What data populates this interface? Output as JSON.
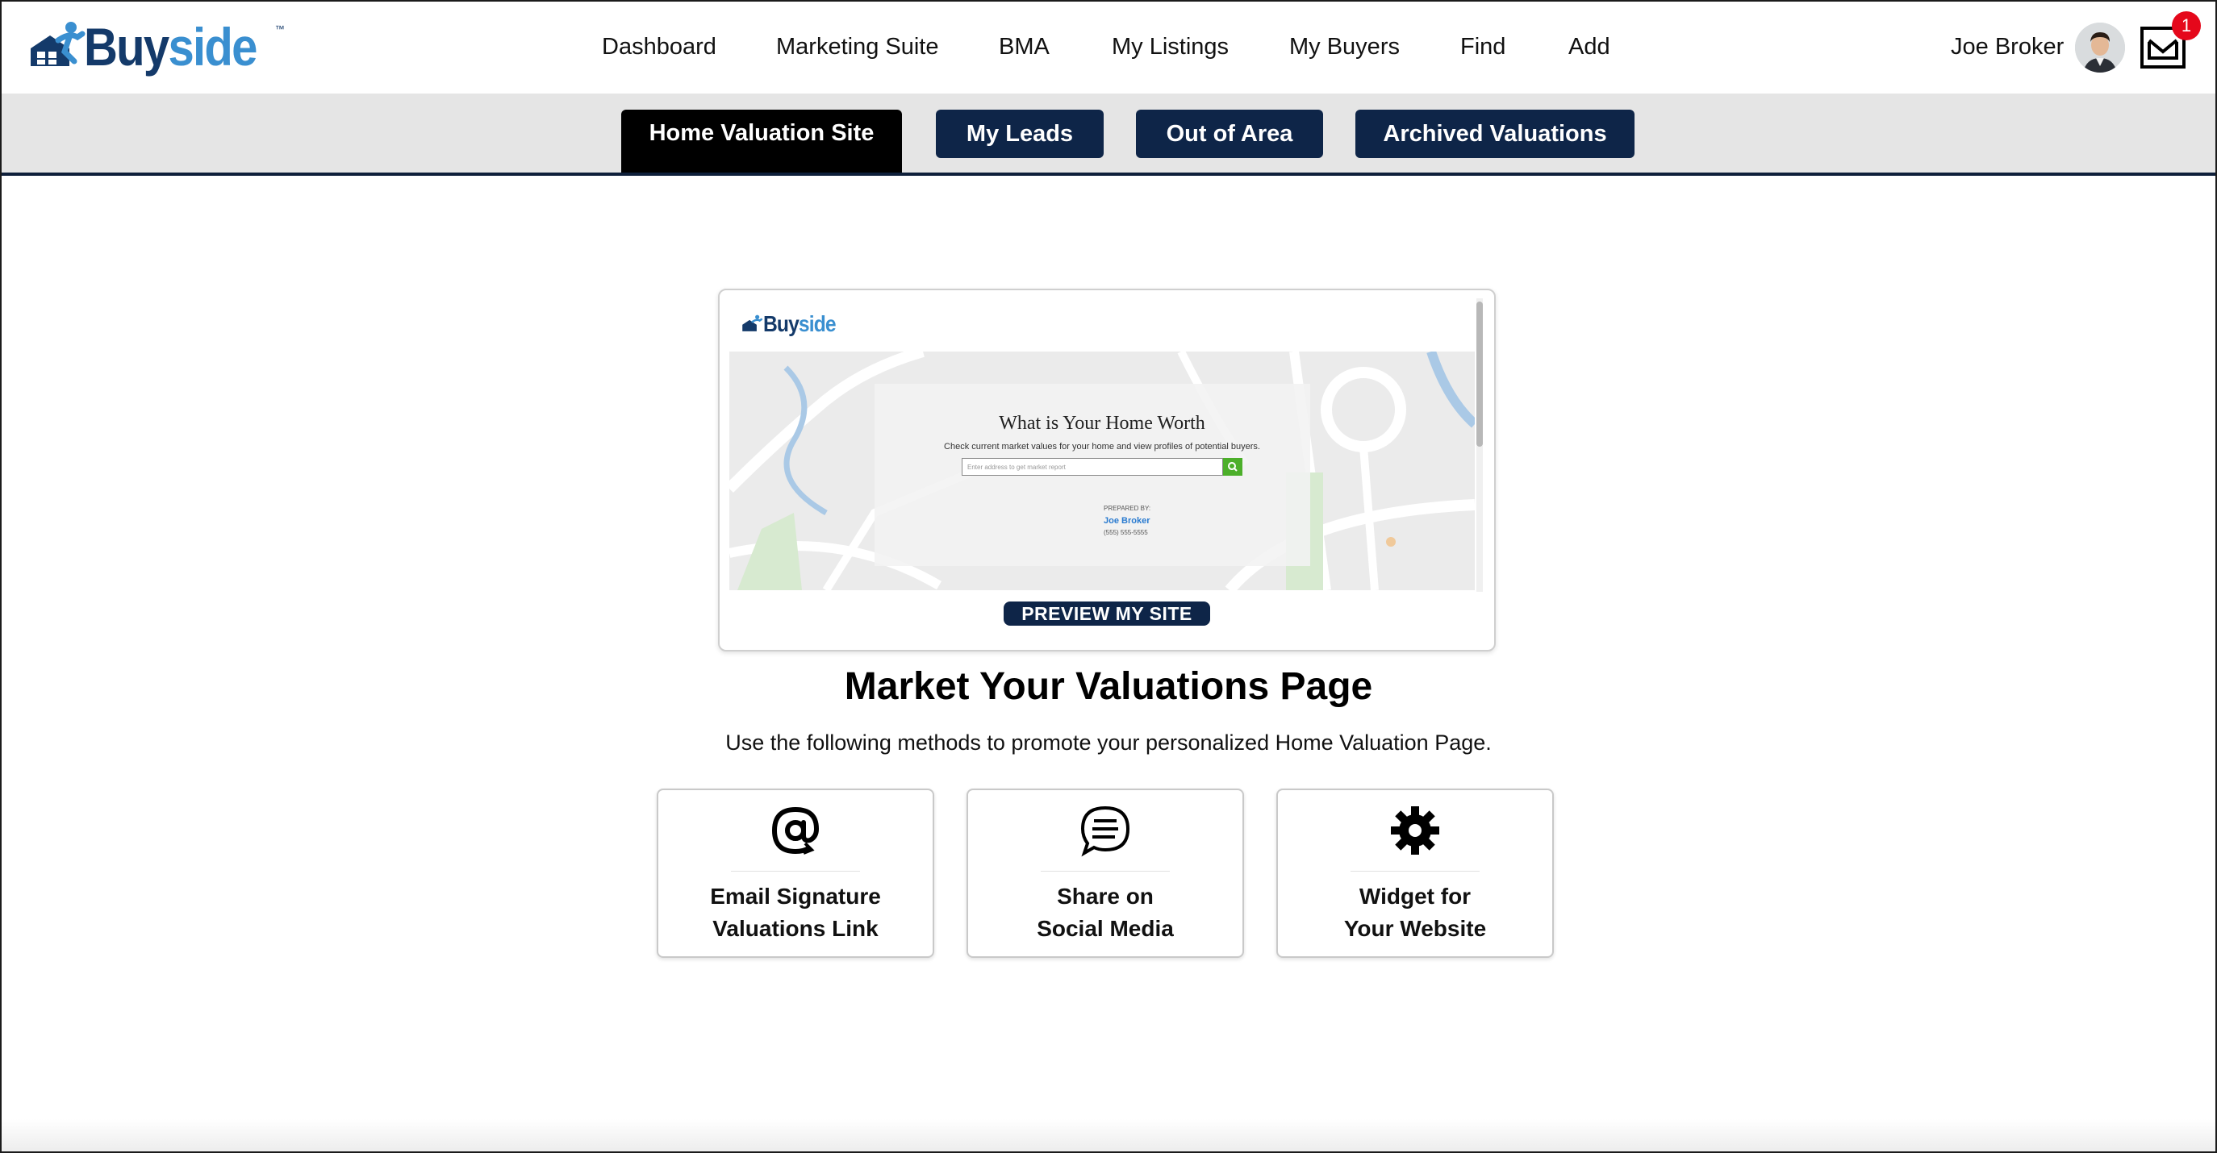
{
  "brand": {
    "logo_buy": "Buy",
    "logo_side": "side",
    "logo_tm": "™"
  },
  "nav": {
    "items": [
      {
        "label": "Dashboard"
      },
      {
        "label": "Marketing Suite"
      },
      {
        "label": "BMA"
      },
      {
        "label": "My Listings"
      },
      {
        "label": "My Buyers"
      },
      {
        "label": "Find"
      },
      {
        "label": "Add"
      }
    ],
    "user_name": "Joe Broker",
    "mail_badge": "1"
  },
  "tabs": [
    {
      "label": "Home Valuation Site",
      "active": true
    },
    {
      "label": "My Leads",
      "active": false
    },
    {
      "label": "Out of Area",
      "active": false
    },
    {
      "label": "Archived Valuations",
      "active": false
    }
  ],
  "preview": {
    "mini_logo_buy": "Buy",
    "mini_logo_side": "side",
    "headline": "What is Your Home Worth",
    "subtext": "Check current market values for your home and view profiles of potential buyers.",
    "search_placeholder": "Enter address to get market report",
    "prepared_by": "PREPARED BY:",
    "agent_name": "Joe Broker",
    "agent_phone": "(555) 555-5555",
    "button_label": "PREVIEW MY SITE"
  },
  "main": {
    "title": "Market Your Valuations Page",
    "subtitle": "Use the following methods to promote your personalized Home Valuation Page."
  },
  "methods": [
    {
      "line1": "Email Signature",
      "line2": "Valuations Link",
      "icon": "at-sign-icon"
    },
    {
      "line1": "Share on",
      "line2": "Social Media",
      "icon": "chat-bubble-icon"
    },
    {
      "line1": "Widget for",
      "line2": "Your Website",
      "icon": "gear-icon"
    }
  ],
  "colors": {
    "navy": "#0e2548",
    "active_tab": "#000000",
    "badge_red": "#e5081b",
    "brand_dark": "#143a6a",
    "brand_light": "#3a8fd0",
    "search_green": "#4caf2a"
  }
}
